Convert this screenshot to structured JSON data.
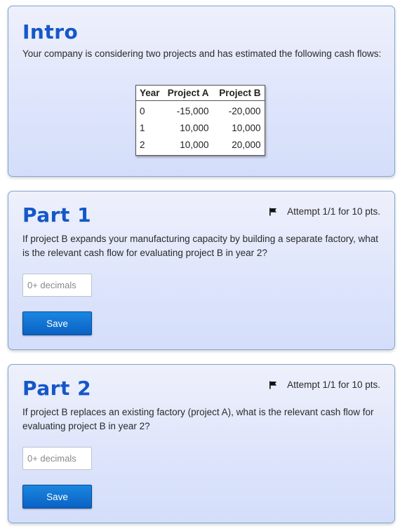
{
  "intro": {
    "title": "Intro",
    "text": "Your company is considering two projects and has estimated the following cash flows:",
    "table": {
      "headers": [
        "Year",
        "Project A",
        "Project B"
      ],
      "rows": [
        [
          "0",
          "-15,000",
          "-20,000"
        ],
        [
          "1",
          "10,000",
          "10,000"
        ],
        [
          "2",
          "10,000",
          "20,000"
        ]
      ]
    }
  },
  "parts": [
    {
      "title": "Part 1",
      "attempt": "Attempt 1/1 for 10 pts.",
      "question": "If project B expands your manufacturing capacity by building a separate factory, what is the relevant cash flow for evaluating project B in year 2?",
      "input_placeholder": "0+ decimals",
      "input_value": "",
      "save_label": "Save"
    },
    {
      "title": "Part 2",
      "attempt": "Attempt 1/1 for 10 pts.",
      "question": "If project B replaces an existing factory (project A), what is the relevant cash flow for evaluating project B in year 2?",
      "input_placeholder": "0+ decimals",
      "input_value": "",
      "save_label": "Save"
    }
  ],
  "icons": {
    "attempt": "flag-icon"
  },
  "colors": {
    "title": "#1457c8",
    "button": "#0a62c4",
    "card_border": "#7fa7cf"
  }
}
